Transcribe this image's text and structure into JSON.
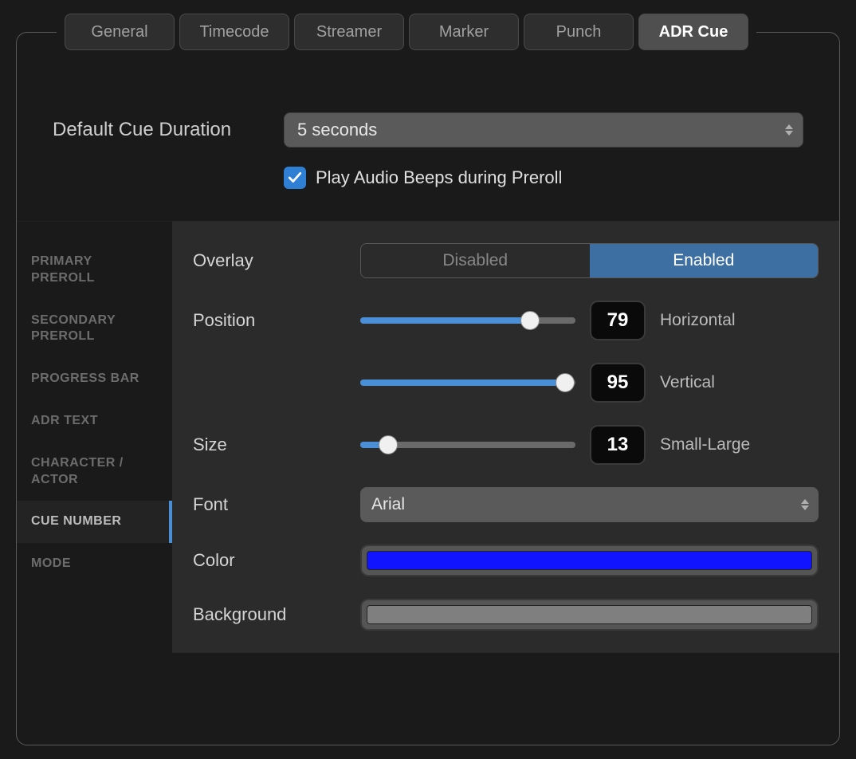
{
  "tabs": {
    "general": "General",
    "timecode": "Timecode",
    "streamer": "Streamer",
    "marker": "Marker",
    "punch": "Punch",
    "adr_cue": "ADR Cue",
    "active": "adr_cue"
  },
  "defaultCueDuration": {
    "label": "Default Cue Duration",
    "value": "5 seconds"
  },
  "playBeeps": {
    "label": "Play Audio Beeps during Preroll",
    "checked": true
  },
  "sidebar": {
    "items": [
      {
        "label": "PRIMARY PREROLL"
      },
      {
        "label": "SECONDARY PREROLL"
      },
      {
        "label": "PROGRESS BAR"
      },
      {
        "label": "ADR TEXT"
      },
      {
        "label": "CHARACTER / ACTOR"
      },
      {
        "label": "CUE NUMBER"
      },
      {
        "label": "MODE"
      }
    ],
    "activeIndex": 5
  },
  "detail": {
    "overlay": {
      "label": "Overlay",
      "options": {
        "disabled": "Disabled",
        "enabled": "Enabled"
      },
      "value": "enabled"
    },
    "position": {
      "label": "Position",
      "horizontal": {
        "value": 79,
        "suffix": "Horizontal"
      },
      "vertical": {
        "value": 95,
        "suffix": "Vertical"
      }
    },
    "size": {
      "label": "Size",
      "value": 13,
      "suffix": "Small-Large"
    },
    "font": {
      "label": "Font",
      "value": "Arial"
    },
    "color": {
      "label": "Color",
      "value": "#1014ff"
    },
    "background": {
      "label": "Background",
      "value": "#7f7f7f"
    }
  }
}
